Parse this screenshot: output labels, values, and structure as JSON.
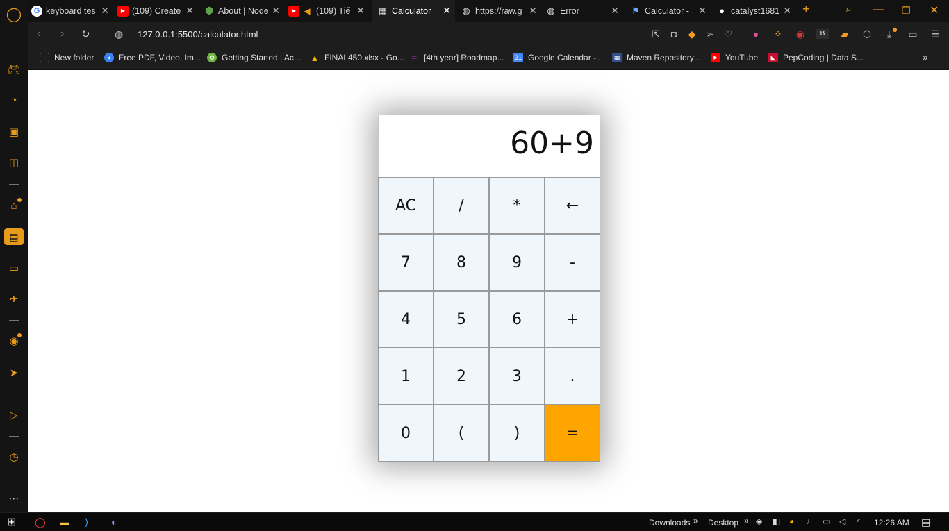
{
  "tabs": [
    {
      "title": "keyboard tes",
      "icon": "google-icon",
      "color": "#4285f4"
    },
    {
      "title": "(109) Create",
      "icon": "youtube-icon",
      "color": "#ff0000"
    },
    {
      "title": "About | Node",
      "icon": "nodejs-icon",
      "color": "#5fa04e"
    },
    {
      "title": "(109) Tiế",
      "icon": "youtube-icon",
      "color": "#ff0000"
    },
    {
      "title": "Calculator",
      "icon": "calculator-icon",
      "color": "#cccccc"
    },
    {
      "title": "https://raw.g",
      "icon": "globe-icon",
      "color": "#cccccc"
    },
    {
      "title": "Error",
      "icon": "globe-icon",
      "color": "#cccccc"
    },
    {
      "title": "Calculator - s",
      "icon": "flag-icon",
      "color": "#6aa7ff"
    },
    {
      "title": "catalyst1681",
      "icon": "github-icon",
      "color": "#ffffff"
    }
  ],
  "address": {
    "url": "127.0.0.1:5500/calculator.html"
  },
  "bookmarks": [
    {
      "label": "New folder",
      "icon": "folder-icon",
      "color": "#d9d9d9"
    },
    {
      "label": "Free PDF, Video, Im...",
      "icon": "pdf-icon",
      "color": "#3b82f6"
    },
    {
      "label": "Getting Started | Ac...",
      "icon": "spring-icon",
      "color": "#6db33f"
    },
    {
      "label": "FINAL450.xlsx - Go...",
      "icon": "drive-icon",
      "color": "#f4b400"
    },
    {
      "label": "[4th year] Roadmap...",
      "icon": "roadmap-icon",
      "color": "#b32bd1"
    },
    {
      "label": "Google Calendar -...",
      "icon": "calendar-icon",
      "color": "#4285f4"
    },
    {
      "label": "Maven Repository:...",
      "icon": "maven-icon",
      "color": "#334e8c"
    },
    {
      "label": "YouTube",
      "icon": "youtube-icon",
      "color": "#ff0000"
    },
    {
      "label": "PepCoding | Data S...",
      "icon": "pepcoding-icon",
      "color": "#c8102e"
    }
  ],
  "calculator": {
    "display": "60+9",
    "keys": [
      "AC",
      "/",
      "*",
      "←",
      "7",
      "8",
      "9",
      "-",
      "4",
      "5",
      "6",
      "+",
      "1",
      "2",
      "3",
      ".",
      "0",
      "(",
      ")",
      "="
    ],
    "equals_color": "#ffa500"
  },
  "taskbar": {
    "downloads_label": "Downloads",
    "desktop_label": "Desktop",
    "time": "12:26 AM"
  },
  "accent_color": "#e89a1a"
}
